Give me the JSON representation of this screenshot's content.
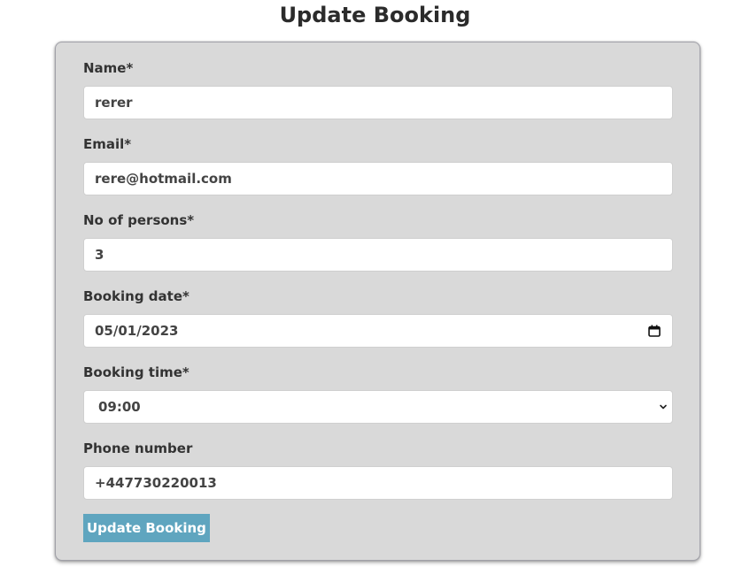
{
  "page": {
    "title": "Update Booking"
  },
  "form": {
    "name": {
      "label": "Name*",
      "value": "rerer"
    },
    "email": {
      "label": "Email*",
      "value": "rere@hotmail.com"
    },
    "persons": {
      "label": "No of persons*",
      "value": "3"
    },
    "booking_date": {
      "label": "Booking date*",
      "value": "05/01/2023",
      "icon": "calendar-icon"
    },
    "booking_time": {
      "label": "Booking time*",
      "selected": "09:00",
      "icon": "chevron-down-icon"
    },
    "phone": {
      "label": "Phone number",
      "value": "+447730220013"
    },
    "submit_label": "Update Booking"
  },
  "colors": {
    "card_background": "#d9d9d9",
    "button_background": "#5fa5bf",
    "button_text": "#ffffff",
    "input_background": "#ffffff"
  }
}
